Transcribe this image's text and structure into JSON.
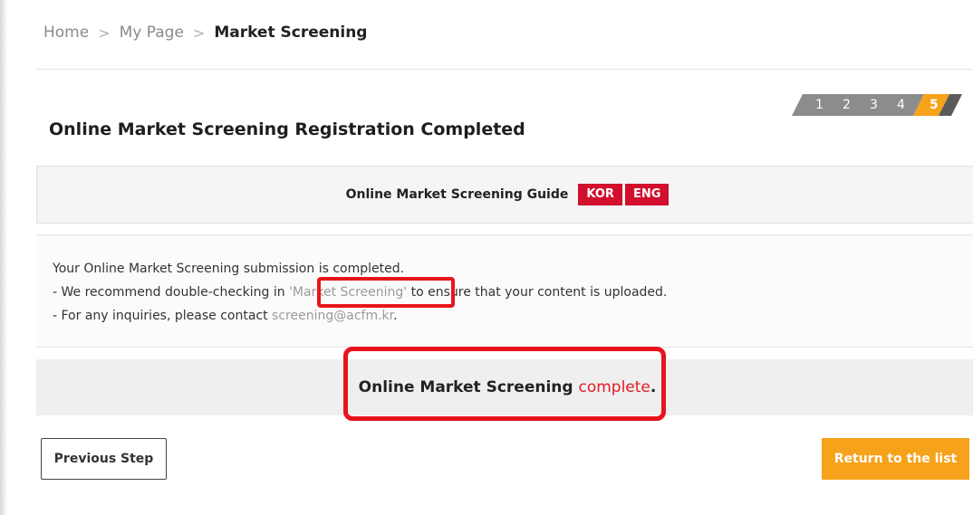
{
  "breadcrumb": {
    "home": "Home",
    "my_page": "My Page",
    "current": "Market Screening",
    "separator": ">"
  },
  "steps": {
    "items": [
      "1",
      "2",
      "3",
      "4",
      "5"
    ],
    "active": "5"
  },
  "page_title": "Online Market Screening Registration Completed",
  "guide": {
    "label": "Online Market Screening Guide",
    "kor": "KOR",
    "eng": "ENG"
  },
  "info": {
    "line1": "Your Online Market Screening submission is completed.",
    "line2_prefix": "- We recommend double-checking in ",
    "line2_link": "'Market Screening'",
    "line2_suffix": " to ensure that your content is uploaded.",
    "line3_prefix": "- For any inquiries, please contact ",
    "line3_email": "screening@acfm.kr",
    "line3_suffix": "."
  },
  "complete": {
    "prefix": "Online Market Screening ",
    "highlight": "complete",
    "suffix": "."
  },
  "buttons": {
    "previous": "Previous Step",
    "return": "Return to the list"
  },
  "colors": {
    "accent_red": "#d2102d",
    "highlight_red": "#e8141c",
    "orange": "#f7a21b",
    "step_grey": "#8c8c8c"
  }
}
